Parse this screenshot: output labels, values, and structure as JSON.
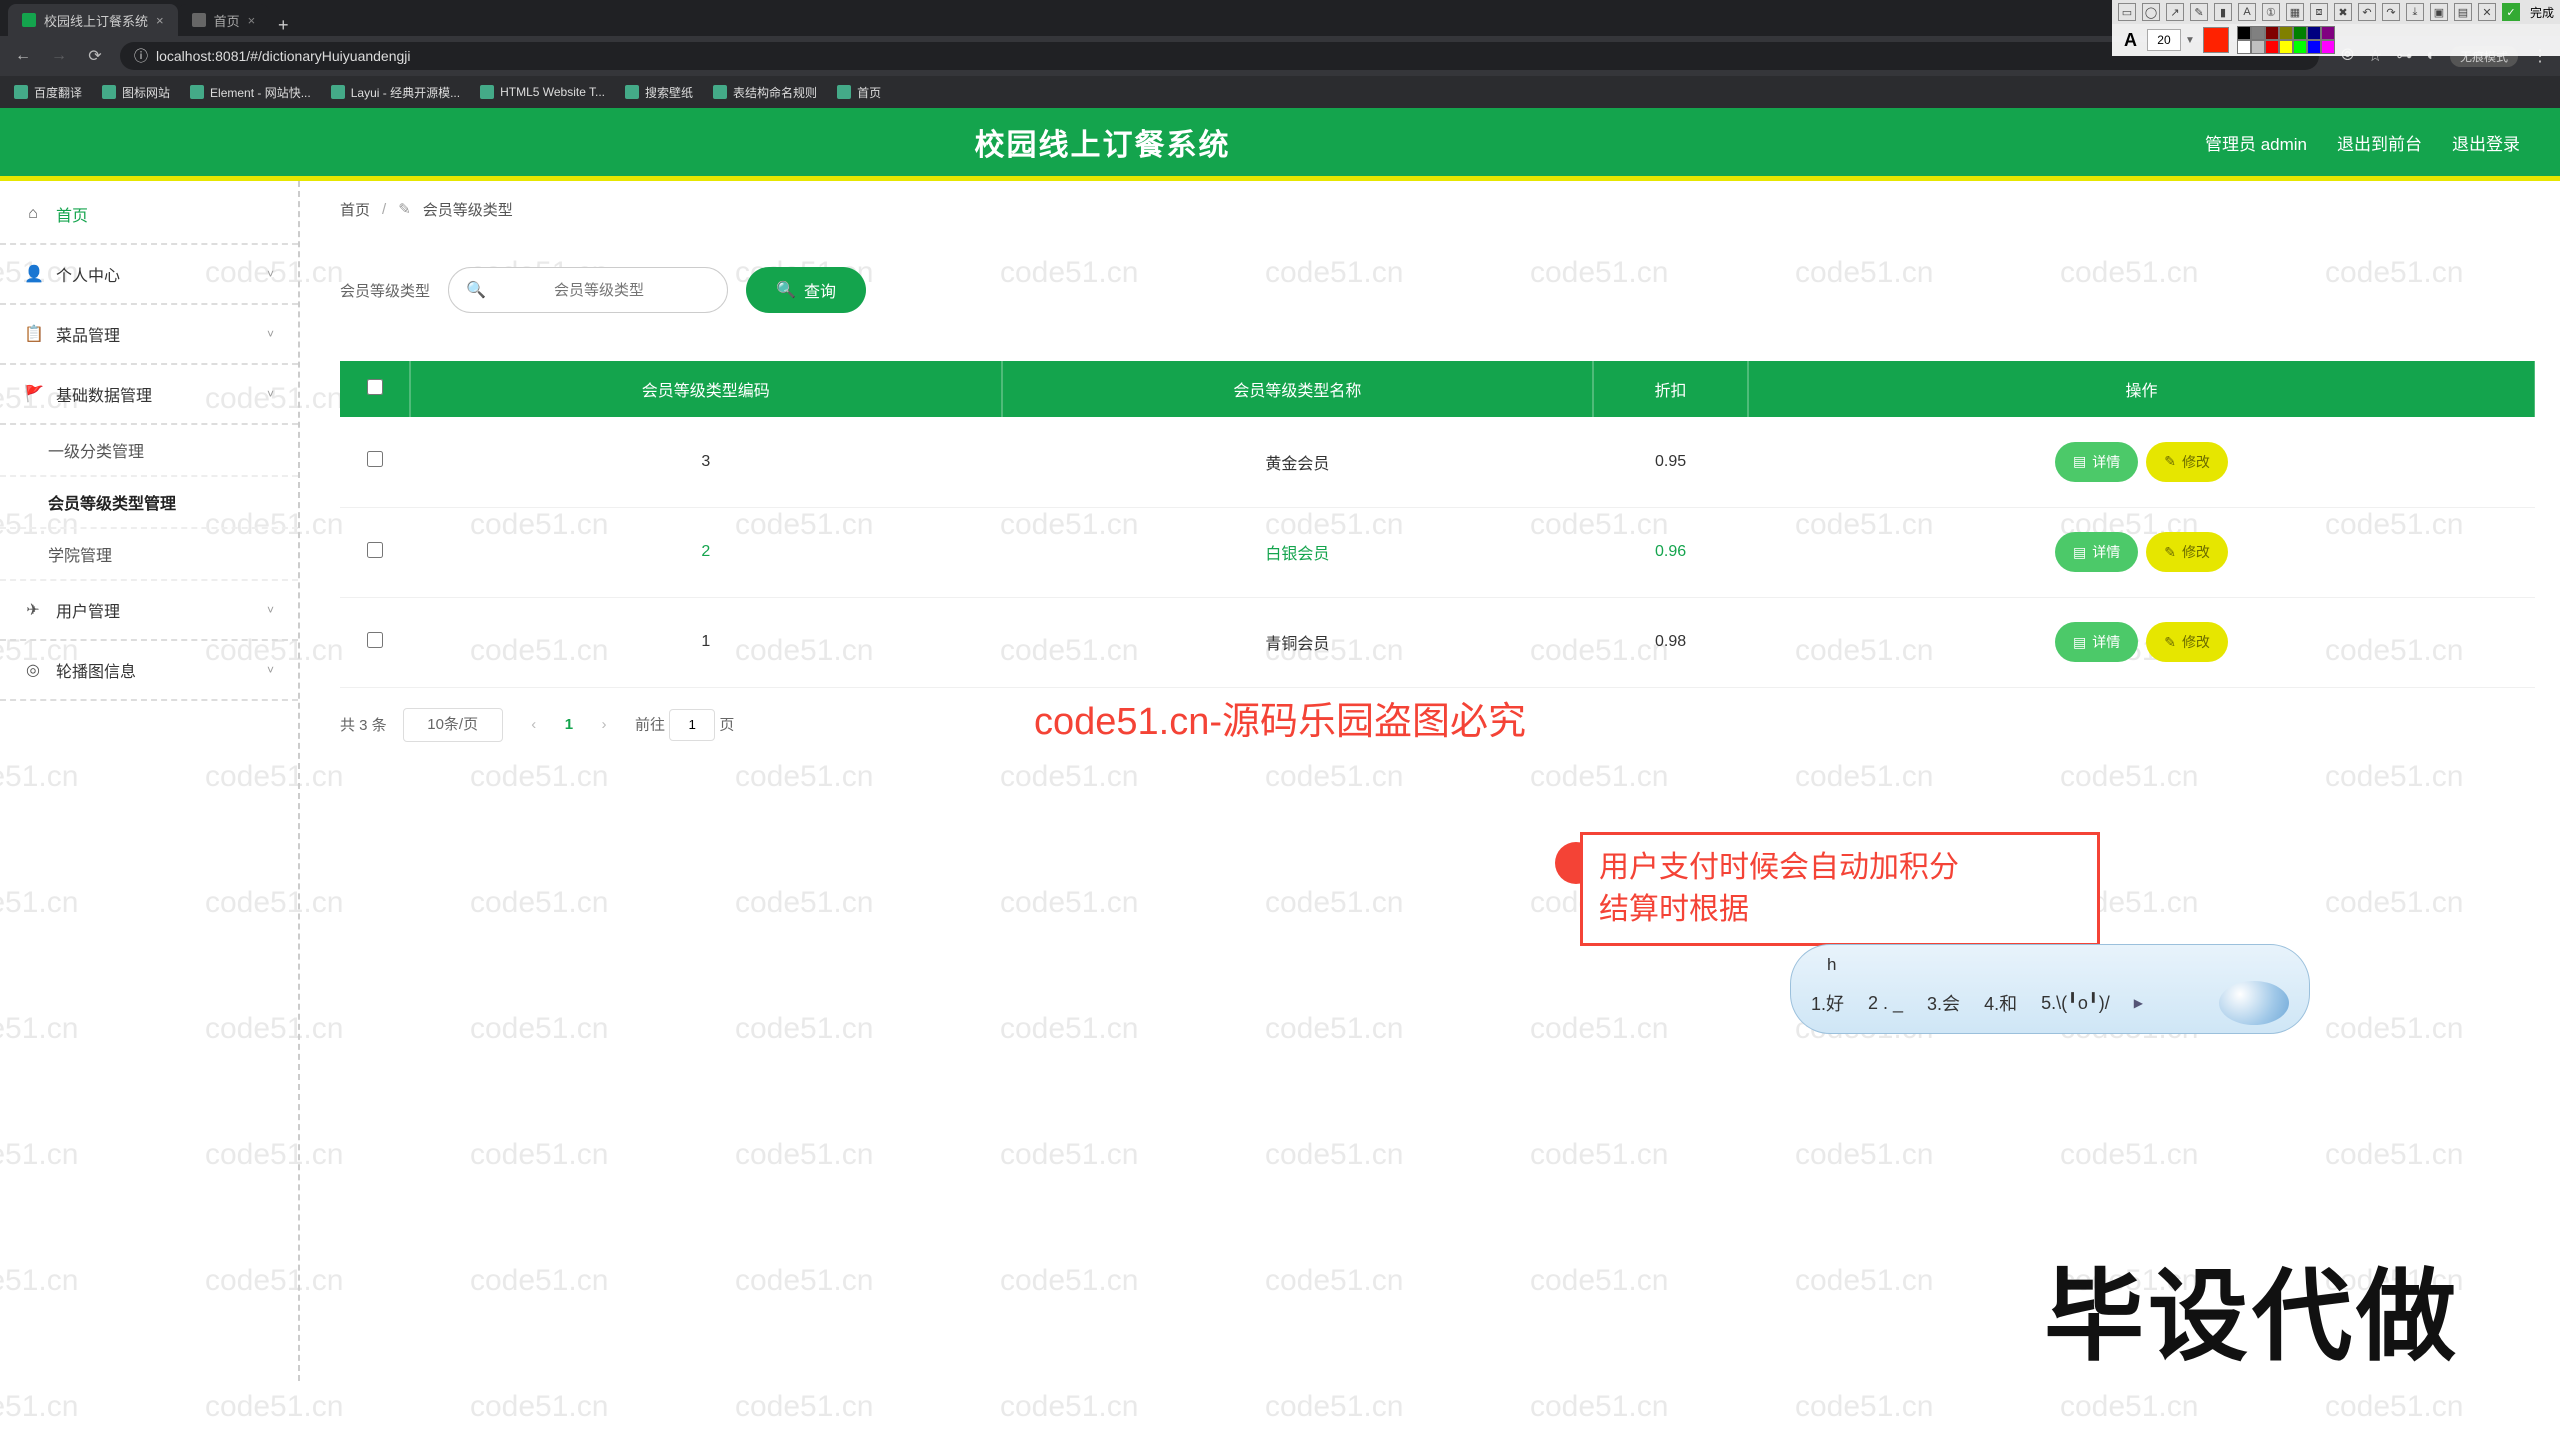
{
  "browser": {
    "tabs": [
      {
        "title": "校园线上订餐系统",
        "favicon": "#14a44d",
        "active": true
      },
      {
        "title": "首页",
        "favicon": "#888",
        "active": false
      }
    ],
    "url": "localhost:8081/#/dictionaryHuiyuandengji",
    "incognito_label": "无痕模式",
    "done_label": "完成",
    "bookmarks": [
      {
        "label": "百度翻译"
      },
      {
        "label": "图标网站"
      },
      {
        "label": "Element - 网站快..."
      },
      {
        "label": "Layui - 经典开源模..."
      },
      {
        "label": "HTML5 Website T..."
      },
      {
        "label": "搜索壁纸"
      },
      {
        "label": "表结构命名规则"
      },
      {
        "label": "首页"
      }
    ]
  },
  "toolbox": {
    "font_size": "20",
    "main_color": "#ff2200",
    "palette": [
      "#000",
      "#808080",
      "#800000",
      "#808000",
      "#008000",
      "#000080",
      "#800080",
      "#fff",
      "#c0c0c0",
      "#f00",
      "#ff0",
      "#0f0",
      "#00f",
      "#f0f"
    ]
  },
  "app": {
    "title": "校园线上订餐系统",
    "admin_label": "管理员 admin",
    "logout_front": "退出到前台",
    "logout_label": "退出登录"
  },
  "sidebar": {
    "home": "首页",
    "items": [
      {
        "label": "个人中心",
        "icon": "👤"
      },
      {
        "label": "菜品管理",
        "icon": "📋"
      },
      {
        "label": "基础数据管理",
        "icon": "🚩",
        "open": true,
        "children": [
          {
            "label": "一级分类管理"
          },
          {
            "label": "会员等级类型管理",
            "active": true
          },
          {
            "label": "学院管理"
          }
        ]
      },
      {
        "label": "用户管理",
        "icon": "✈"
      },
      {
        "label": "轮播图信息",
        "icon": "◎"
      }
    ]
  },
  "crumb": {
    "root": "首页",
    "current": "会员等级类型"
  },
  "search": {
    "label": "会员等级类型",
    "placeholder": "会员等级类型",
    "query_btn": "查询"
  },
  "table": {
    "headers": [
      "",
      "会员等级类型编码",
      "会员等级类型名称",
      "折扣",
      "操作"
    ],
    "rows": [
      {
        "code": "3",
        "name": "黄金会员",
        "discount": "0.95"
      },
      {
        "code": "2",
        "name": "白银会员",
        "discount": "0.96"
      },
      {
        "code": "1",
        "name": "青铜会员",
        "discount": "0.98"
      }
    ],
    "detail_btn": "详情",
    "edit_btn": "修改"
  },
  "pager": {
    "total": "共 3 条",
    "page_size": "10条/页",
    "current": "1",
    "goto_label": "前往",
    "goto_value": "1",
    "page_suffix": "页"
  },
  "annotation": {
    "line1": "用户支付时候会自动加积分",
    "line2": "结算时根据"
  },
  "ime": {
    "typed": "h",
    "candidates": [
      "1.好",
      "2 . _",
      "3.会",
      "4.和",
      "5.\\(╹o╹)/"
    ]
  },
  "center_text": "code51.cn-源码乐园盗图必究",
  "brand": "毕设代做",
  "watermark": "code51.cn"
}
